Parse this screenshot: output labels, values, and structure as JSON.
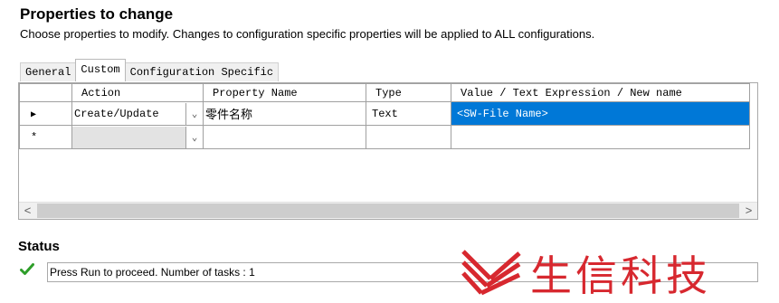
{
  "header": {
    "title": "Properties to change",
    "subtitle": "Choose properties to modify.  Changes to configuration specific properties will be applied to ALL configurations."
  },
  "tabs": [
    {
      "label": "General",
      "active": false
    },
    {
      "label": "Custom",
      "active": true
    },
    {
      "label": "Configuration Specific",
      "active": false
    }
  ],
  "grid": {
    "columns": [
      "Action",
      "Property Name",
      "Type",
      "Value / Text Expression / New name"
    ],
    "rows": [
      {
        "marker": "▶",
        "action": "Create/Update",
        "property_name": "零件名称",
        "type": "Text",
        "value": "<SW-File Name>",
        "value_selected": true
      },
      {
        "marker": "*",
        "action": "",
        "property_name": "",
        "type": "",
        "value": ""
      }
    ],
    "scroll_left": "<",
    "scroll_right": ">"
  },
  "status": {
    "title": "Status",
    "icon": "checkmark-icon",
    "message": "Press Run to proceed. Number of tasks : 1"
  },
  "watermark": {
    "text": "生信科技",
    "color": "#d7282f"
  },
  "colors": {
    "selection": "#0078d7"
  }
}
